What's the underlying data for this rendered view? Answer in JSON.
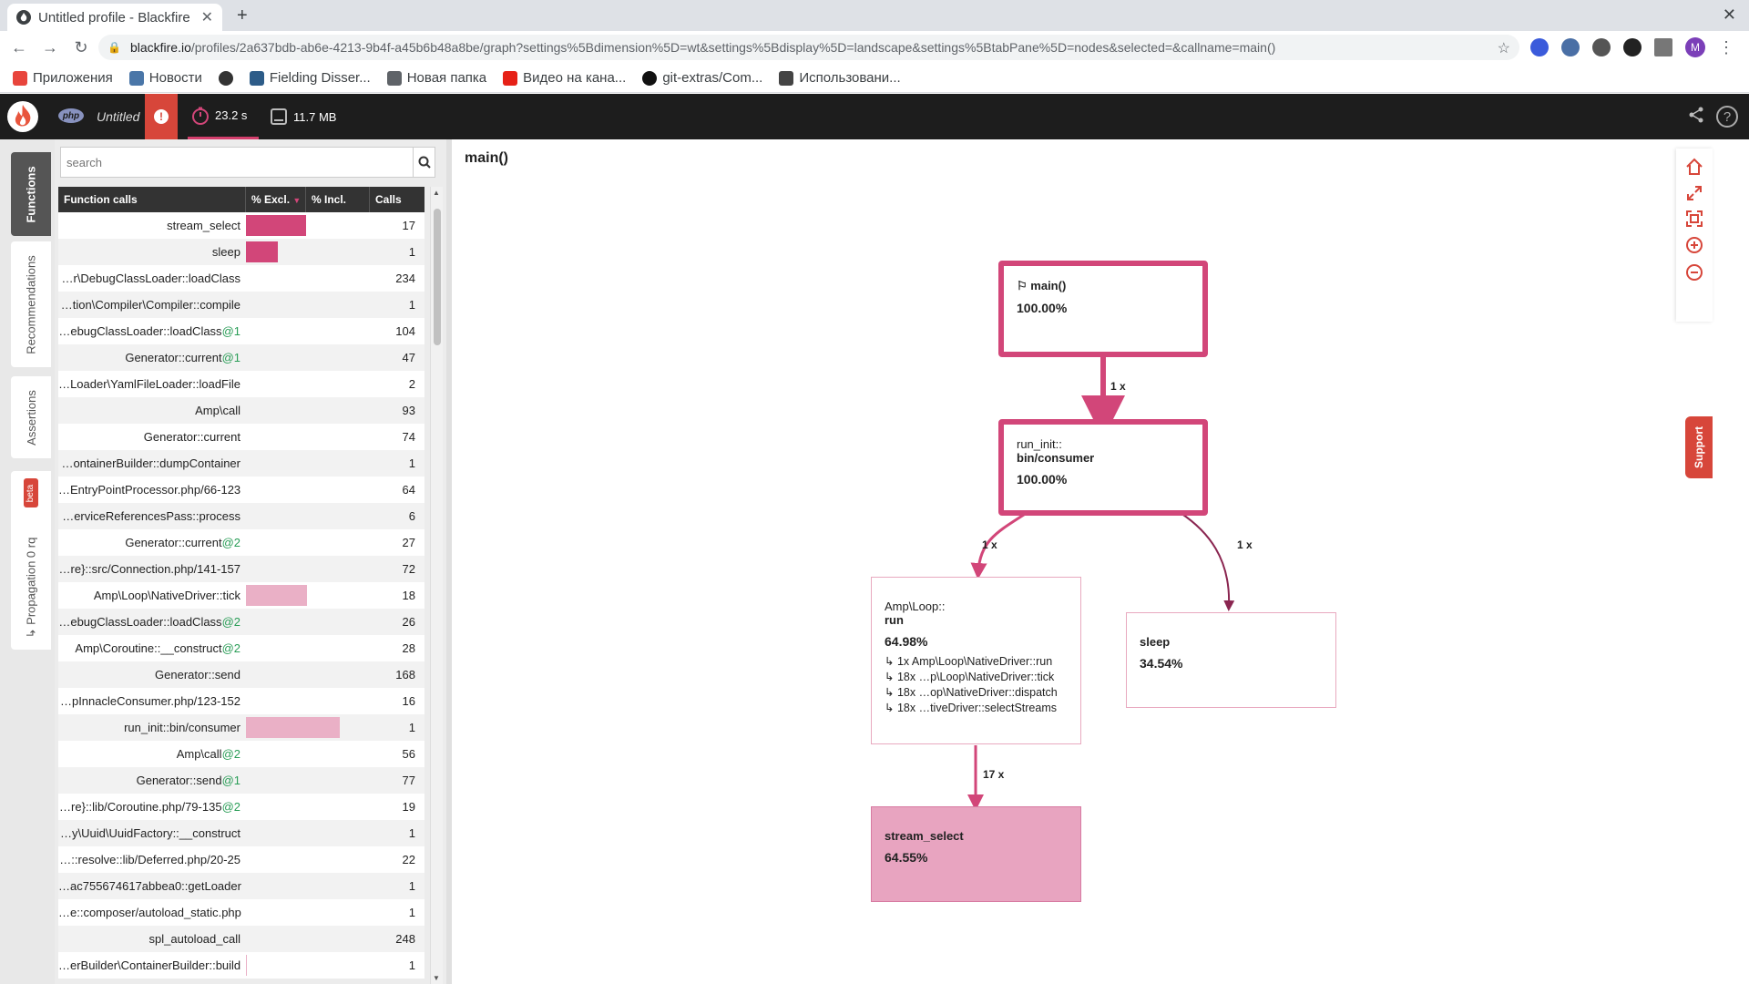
{
  "browser": {
    "tab_title": "Untitled profile - Blackfire",
    "url_host": "blackfire.io",
    "url_path": "/profiles/2a637bdb-ab6e-4213-9b4f-a45b6b48a8be/graph?settings%5Bdimension%5D=wt&settings%5Bdisplay%5D=landscape&settings%5BtabPane%5D=nodes&selected=&callname=main()",
    "avatar_letter": "M",
    "bookmarks": [
      "Приложения",
      "Новости",
      "Fielding Disser...",
      "Новая папка",
      "Видео на кана...",
      "git-extras/Com...",
      "Использовани..."
    ]
  },
  "app": {
    "php_badge": "php",
    "profile_name": "Untitled",
    "time": "23.2 s",
    "memory": "11.7 MB",
    "colors": {
      "accent": "#d24679",
      "accent_light": "#eab0c6",
      "header": "#1d1d1d",
      "alert": "#d7463a"
    }
  },
  "sidetabs": {
    "functions": "Functions",
    "recommendations": "Recommendations",
    "assertions": "Assertions",
    "propagation": "↳ Propagation 0 rq",
    "beta": "beta"
  },
  "panel": {
    "search_placeholder": "search",
    "columns": {
      "name": "Function calls",
      "excl": "% Excl.",
      "incl": "% Incl.",
      "calls": "Calls"
    },
    "rows": [
      {
        "name": "stream_select",
        "suffix": "",
        "calls": "17",
        "excl": 0.486,
        "incl": 0
      },
      {
        "name": "sleep",
        "suffix": "",
        "calls": "1",
        "excl": 0.26,
        "incl": 0
      },
      {
        "name": "…r\\DebugClassLoader::loadClass",
        "suffix": "",
        "calls": "234",
        "excl": 0,
        "incl": 0
      },
      {
        "name": "…tion\\Compiler\\Compiler::compile",
        "suffix": "",
        "calls": "1",
        "excl": 0,
        "incl": 0
      },
      {
        "name": "…ebugClassLoader::loadClass",
        "suffix": "@1",
        "calls": "104",
        "excl": 0,
        "incl": 0
      },
      {
        "name": "Generator::current",
        "suffix": "@1",
        "calls": "47",
        "excl": 0,
        "incl": 0
      },
      {
        "name": "…Loader\\YamlFileLoader::loadFile",
        "suffix": "",
        "calls": "2",
        "excl": 0,
        "incl": 0
      },
      {
        "name": "Amp\\call",
        "suffix": "",
        "calls": "93",
        "excl": 0,
        "incl": 0
      },
      {
        "name": "Generator::current",
        "suffix": "",
        "calls": "74",
        "excl": 0,
        "incl": 0
      },
      {
        "name": "…ontainerBuilder::dumpContainer",
        "suffix": "",
        "calls": "1",
        "excl": 0,
        "incl": 0
      },
      {
        "name": "…EntryPointProcessor.php/66-123",
        "suffix": "",
        "calls": "64",
        "excl": 0,
        "incl": 0
      },
      {
        "name": "…erviceReferencesPass::process",
        "suffix": "",
        "calls": "6",
        "excl": 0,
        "incl": 0
      },
      {
        "name": "Generator::current",
        "suffix": "@2",
        "calls": "27",
        "excl": 0,
        "incl": 0
      },
      {
        "name": "…re}::src/Connection.php/141-157",
        "suffix": "",
        "calls": "72",
        "excl": 0,
        "incl": 0
      },
      {
        "name": "Amp\\Loop\\NativeDriver::tick",
        "suffix": "",
        "calls": "18",
        "excl": 0,
        "incl": 0.49
      },
      {
        "name": "…ebugClassLoader::loadClass",
        "suffix": "@2",
        "calls": "26",
        "excl": 0,
        "incl": 0
      },
      {
        "name": "Amp\\Coroutine::__construct",
        "suffix": "@2",
        "calls": "28",
        "excl": 0,
        "incl": 0
      },
      {
        "name": "Generator::send",
        "suffix": "",
        "calls": "168",
        "excl": 0,
        "incl": 0
      },
      {
        "name": "…pInnacleConsumer.php/123-152",
        "suffix": "",
        "calls": "16",
        "excl": 0,
        "incl": 0
      },
      {
        "name": "run_init::bin/consumer",
        "suffix": "",
        "calls": "1",
        "excl": 0,
        "incl": 0.76
      },
      {
        "name": "Amp\\call",
        "suffix": "@2",
        "calls": "56",
        "excl": 0,
        "incl": 0
      },
      {
        "name": "Generator::send",
        "suffix": "@1",
        "calls": "77",
        "excl": 0,
        "incl": 0
      },
      {
        "name": "…re}::lib/Coroutine.php/79-135",
        "suffix": "@2",
        "calls": "19",
        "excl": 0,
        "incl": 0
      },
      {
        "name": "…y\\Uuid\\UuidFactory::__construct",
        "suffix": "",
        "calls": "1",
        "excl": 0,
        "incl": 0
      },
      {
        "name": "…::resolve::lib/Deferred.php/20-25",
        "suffix": "",
        "calls": "22",
        "excl": 0,
        "incl": 0
      },
      {
        "name": "…ac755674617abbea0::getLoader",
        "suffix": "",
        "calls": "1",
        "excl": 0,
        "incl": 0
      },
      {
        "name": "…e::composer/autoload_static.php",
        "suffix": "",
        "calls": "1",
        "excl": 0,
        "incl": 0
      },
      {
        "name": "spl_autoload_call",
        "suffix": "",
        "calls": "248",
        "excl": 0,
        "incl": 0
      },
      {
        "name": "…erBuilder\\ContainerBuilder::build",
        "suffix": "",
        "calls": "1",
        "excl": 0,
        "incl": 0.01
      }
    ]
  },
  "graph": {
    "title": "main()",
    "nodes": {
      "main": {
        "name": "main()",
        "pct": "100.00%"
      },
      "run_init": {
        "line1": "run_init::",
        "line2": "bin/consumer",
        "pct": "100.00%"
      },
      "loop": {
        "line1": "Amp\\Loop::",
        "line2": "run",
        "pct": "64.98%",
        "children": [
          "↳ 1x  Amp\\Loop\\NativeDriver::run",
          "↳ 18x  …p\\Loop\\NativeDriver::tick",
          "↳ 18x  …op\\NativeDriver::dispatch",
          "↳ 18x  …tiveDriver::selectStreams"
        ]
      },
      "sleep": {
        "name": "sleep",
        "pct": "34.54%"
      },
      "stream_select": {
        "name": "stream_select",
        "pct": "64.55%"
      }
    },
    "edges": {
      "main_run": "1 x",
      "run_loop": "1 x",
      "run_sleep": "1 x",
      "loop_select": "17 x"
    }
  },
  "support_label": "Support"
}
